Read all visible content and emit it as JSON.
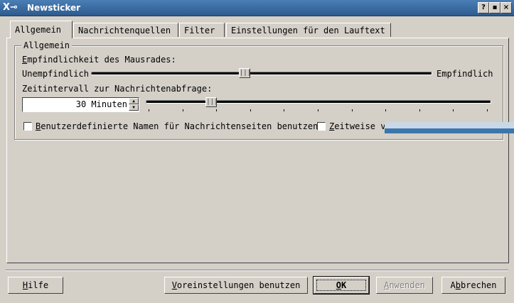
{
  "window": {
    "title": "Newsticker",
    "logo": "X⊸",
    "help_btn": "?",
    "min_btn": "▪",
    "close_btn": "×"
  },
  "tabs": [
    {
      "label": "Allgemein",
      "active": true
    },
    {
      "label": "Nachrichtenquellen",
      "active": false
    },
    {
      "label": "Filter",
      "active": false
    },
    {
      "label": "Einstellungen für den Lauftext",
      "active": false
    }
  ],
  "group": {
    "title": "Allgemein",
    "mousewheel_label_rest": "mpfindlichkeit des Mausrades:",
    "mousewheel_label_key": "E",
    "slider_min_label": "Unempfindlich",
    "slider_max_label": "Empfindlich",
    "mousewheel_value": 0.45,
    "interval_label": "Zeitintervall zur Nachrichtenabfrage:",
    "interval_value": "30 Minuten",
    "interval_slider_value": 0.18,
    "checkbox_custom_names_key": "B",
    "checkbox_custom_names_rest": "enutzerdefinierte Namen für Nachrichtenseiten benutzen",
    "checkbox_custom_names_checked": false,
    "checkbox_time_key": "Z",
    "checkbox_time_rest": "eitweise v",
    "checkbox_time_checked": false
  },
  "buttons": {
    "help_key": "H",
    "help_rest": "ilfe",
    "defaults_key": "V",
    "defaults_rest": "oreinstellungen benutzen",
    "ok_key": "O",
    "ok_rest": "K",
    "apply_key": "A",
    "apply_rest": "nwenden",
    "cancel_pre": "A",
    "cancel_key": "b",
    "cancel_rest": "brechen"
  }
}
